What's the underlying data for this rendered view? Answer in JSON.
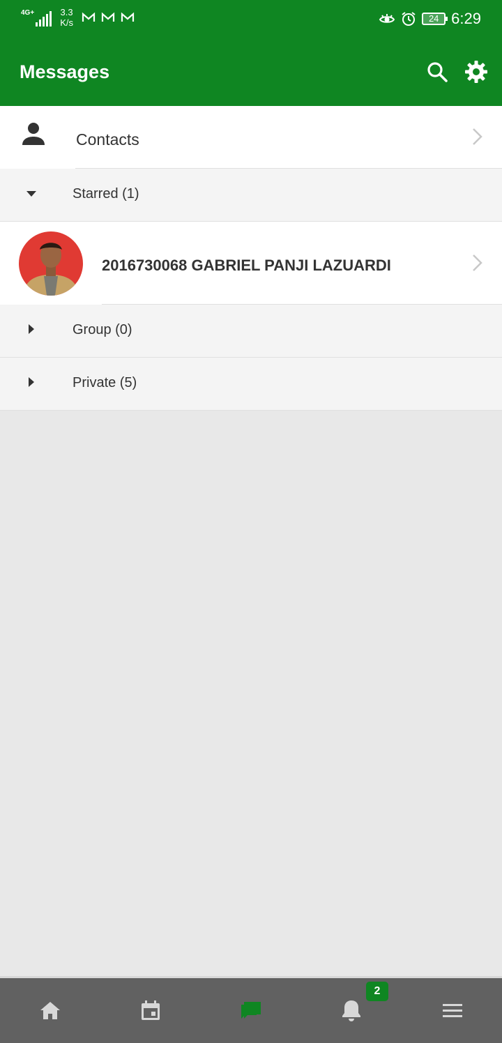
{
  "status_bar": {
    "network_type": "4G+",
    "speed_value": "3.3",
    "speed_unit": "K/s",
    "battery": "24",
    "time": "6:29"
  },
  "app_bar": {
    "title": "Messages",
    "icons": [
      "search-icon",
      "settings-gear-icon"
    ]
  },
  "contacts_row": {
    "label": "Contacts",
    "icon": "person-icon"
  },
  "sections": {
    "starred": {
      "label": "Starred (1)",
      "expanded": true
    },
    "group": {
      "label": "Group (0)",
      "expanded": false
    },
    "private": {
      "label": "Private (5)",
      "expanded": false
    }
  },
  "starred_contacts": [
    {
      "name": "2016730068 GABRIEL PANJI LAZUARDI"
    }
  ],
  "bottom_nav": {
    "items": [
      "home-icon",
      "calendar-icon",
      "messages-icon",
      "notifications-icon",
      "menu-icon"
    ],
    "active": "messages-icon",
    "notifications_badge": "2"
  },
  "colors": {
    "primary": "#0f8622",
    "nav_background": "#616161",
    "page_background": "#e8e8e8"
  }
}
